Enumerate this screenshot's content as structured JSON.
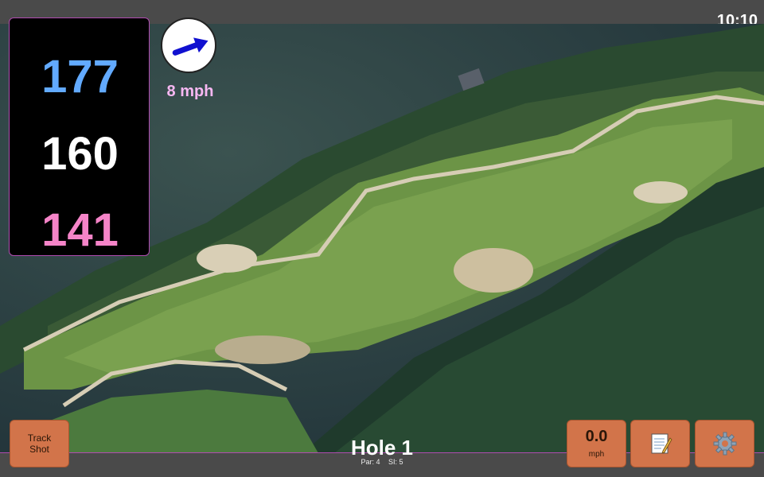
{
  "status": {
    "time": "10:10"
  },
  "yardages": {
    "back": "177",
    "middle": "160",
    "front": "141"
  },
  "colors": {
    "back": "#62aaff",
    "middle": "#ffffff",
    "front": "#f584c8",
    "button": "#d2744a",
    "border": "#b04bb0"
  },
  "wind": {
    "speed": "8 mph",
    "direction_icon": "arrow-icon"
  },
  "buttons": {
    "track_shot": "Track\nShot",
    "speed_value": "0.0",
    "speed_unit": "mph",
    "notes_icon": "notepad-icon",
    "settings_icon": "gear-icon"
  },
  "hole": {
    "name": "Hole 1",
    "par": "Par: 4",
    "si": "SI: 5"
  }
}
